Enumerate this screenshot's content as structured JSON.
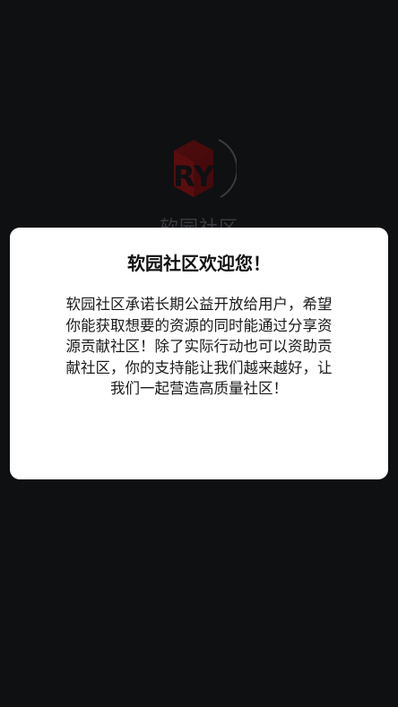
{
  "splash": {
    "logo_icon": "ry-cube-logo-icon",
    "app_name": "软园社区"
  },
  "dialog": {
    "title": "软园社区欢迎您！",
    "body_lines": [
      "软园社区承诺长期公益开放给用户，希望",
      "你能获取想要的资源的同时能通过分享资",
      "源贡献社区！除了实际行动也可以资助贡",
      "献社区，你的支持能让我们越来越好，让",
      "我们一起营造高质量社区！"
    ]
  },
  "colors": {
    "background": "#0f1012",
    "dialog_background": "#ffffff",
    "logo_red": "#5a0d0f",
    "text": "#111111"
  }
}
